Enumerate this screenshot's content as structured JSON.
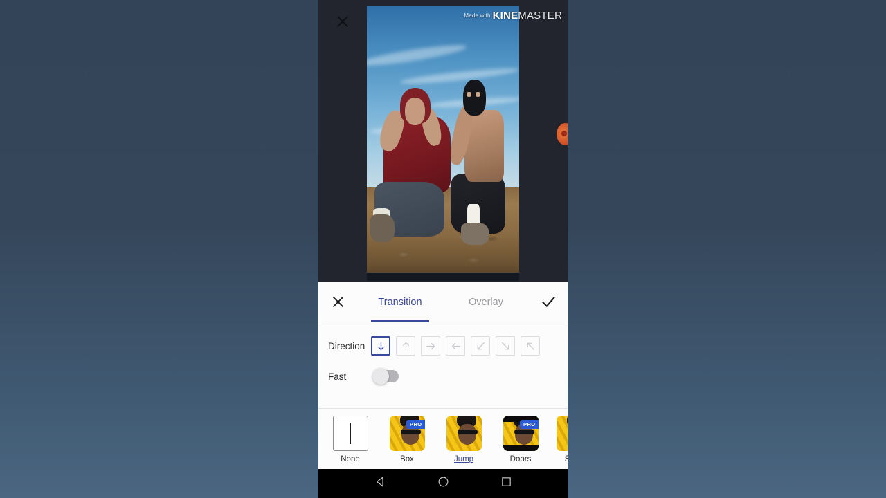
{
  "app": {
    "watermark_prefix": "Made with",
    "watermark_bold": "KINE",
    "watermark_light": "MASTER"
  },
  "preview": {
    "close_icon": "close-icon",
    "handle_icon": "timeline-handle-icon"
  },
  "panel": {
    "close_label": "close-icon",
    "done_label": "check-icon",
    "tabs": [
      {
        "label": "Transition",
        "active": true
      },
      {
        "label": "Overlay",
        "active": false
      }
    ]
  },
  "options": {
    "direction": {
      "label": "Direction",
      "items": [
        {
          "name": "down",
          "glyph": "↓",
          "selected": true
        },
        {
          "name": "up",
          "glyph": "↑",
          "selected": false
        },
        {
          "name": "right",
          "glyph": "→",
          "selected": false
        },
        {
          "name": "left",
          "glyph": "←",
          "selected": false
        },
        {
          "name": "down-left",
          "glyph": "↙",
          "selected": false
        },
        {
          "name": "down-right",
          "glyph": "↘",
          "selected": false
        },
        {
          "name": "up-left",
          "glyph": "↖",
          "selected": false
        }
      ]
    },
    "fast": {
      "label": "Fast",
      "enabled": false
    }
  },
  "transitions": [
    {
      "label": "None",
      "pro": false,
      "selected": false,
      "type": "none"
    },
    {
      "label": "Box",
      "pro": true,
      "selected": false,
      "type": "photo",
      "pro_label": "PRO"
    },
    {
      "label": "Jump",
      "pro": false,
      "selected": true,
      "type": "photo"
    },
    {
      "label": "Doors",
      "pro": true,
      "selected": false,
      "type": "photo-letterbox",
      "pro_label": "PRO"
    },
    {
      "label": "St",
      "pro": false,
      "selected": false,
      "type": "photo"
    }
  ],
  "navbar": {
    "back": "back-triangle-icon",
    "home": "home-circle-icon",
    "recents": "recents-square-icon"
  },
  "colors": {
    "accent": "#3b4a9e",
    "pro_badge": "#2a5bd7",
    "panel_bg": "#fcfcfc",
    "thumb_yellow": "#f5c518"
  }
}
